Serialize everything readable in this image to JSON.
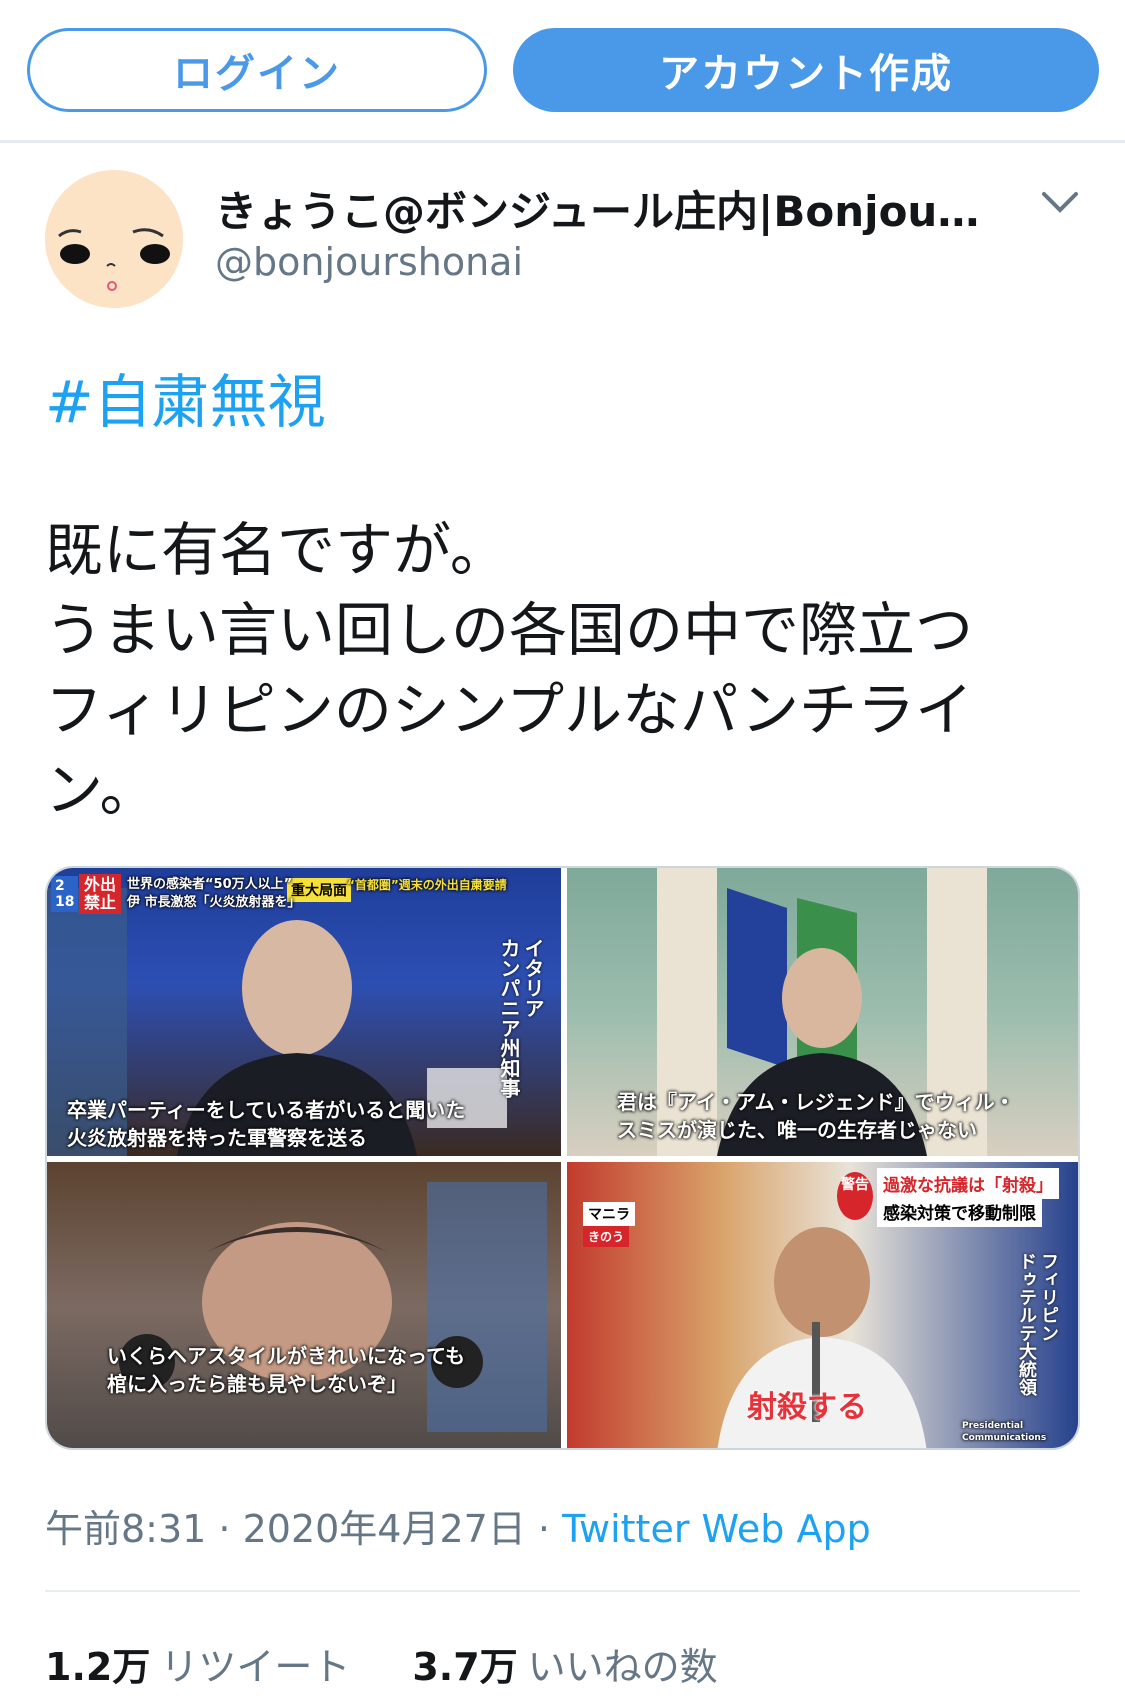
{
  "header": {
    "login_label": "ログイン",
    "signup_label": "アカウント作成"
  },
  "tweet": {
    "display_name": "きょうこ@ボンジュール庄内|Bonjour ...",
    "handle": "@bonjourshonai",
    "hashtag": "#自粛無視",
    "text_lines": [
      "既に有名ですが。",
      "うまい言い回しの各国の中で際立つ",
      "フィリピンのシンプルなパンチライ",
      "ン。"
    ],
    "media": {
      "img1": {
        "badge_num": "2\n18",
        "badge_red": "外出\n禁止",
        "top_caption": "世界の感染者“50万人以上”",
        "top_caption2": "伊 市長激怒「火炎放射器を」",
        "tag_yellow": "重大局面",
        "tag_yellow2": "“首都圏”週末の外出自粛要請",
        "side_label": "イタリア\nカンパニア州知事",
        "caption": "卒業パーティーをしている者がいると聞いた\n火炎放射器を持った軍警察を送る"
      },
      "img2": {
        "caption": "君は『アイ・アム・レジェンド』でウィル・\nスミスが演じた、唯一の生存者じゃない"
      },
      "img3": {
        "caption": "いくらヘアスタイルがきれいになっても\n棺に入ったら誰も見やしないぞ」"
      },
      "img4": {
        "warning": "警告",
        "headline1": "過激な抗議は「射殺」",
        "headline2": "感染対策で移動制限",
        "location": "マニラ",
        "when": "きのう",
        "side_label": "フィリピン\nドゥテルテ大統領",
        "caption": "射殺する",
        "credit": "Presidential Communications"
      }
    },
    "time": "午前8:31",
    "sep1": " · ",
    "date": "2020年4月27日",
    "sep2": " · ",
    "source": "Twitter Web App",
    "retweet_count": "1.2万",
    "retweet_label": "リツイート",
    "like_count": "3.7万",
    "like_label": "いいねの数"
  },
  "colors": {
    "accent": "#4a99e9",
    "link": "#1da1f2",
    "muted": "#657786"
  }
}
